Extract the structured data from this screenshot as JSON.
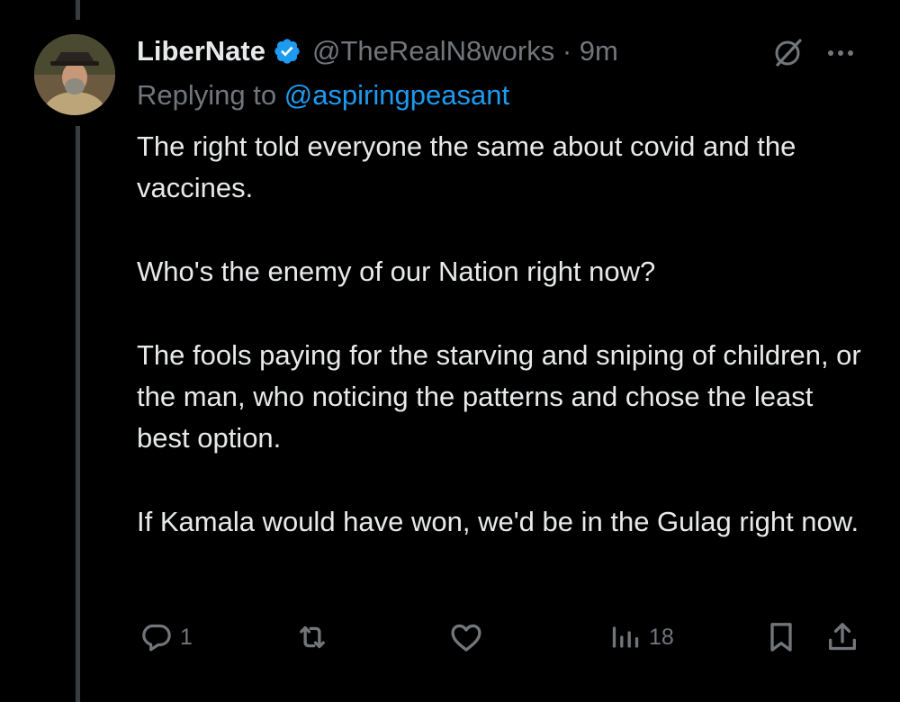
{
  "tweet": {
    "author_name": "LiberNate",
    "handle": "@TheRealN8works",
    "separator": "·",
    "time": "9m",
    "replying_prefix": "Replying to",
    "replying_handle": "@aspiringpeasant",
    "paragraphs": [
      "The right told everyone the same about covid and the vaccines.",
      "Who's the enemy of our Nation right now?",
      "The fools paying for the starving and sniping of children, or the man, who noticing the patterns and chose the least best option.",
      "If Kamala would have won, we'd be in the Gulag right now."
    ],
    "verified": true
  },
  "actions": {
    "reply_count": "1",
    "retweet_count": "",
    "like_count": "",
    "views_count": "18"
  },
  "icons": {
    "verified": "verified-badge-icon",
    "grok": "grok-icon",
    "more": "more-icon",
    "reply": "reply-icon",
    "retweet": "retweet-icon",
    "like": "heart-icon",
    "views": "analytics-icon",
    "bookmark": "bookmark-icon",
    "share": "share-icon"
  },
  "colors": {
    "background": "#000000",
    "text": "#e7e9ea",
    "secondary": "#71767b",
    "link": "#1d9bf0",
    "verified": "#1d9bf0",
    "thread_line": "#3a3d40"
  }
}
